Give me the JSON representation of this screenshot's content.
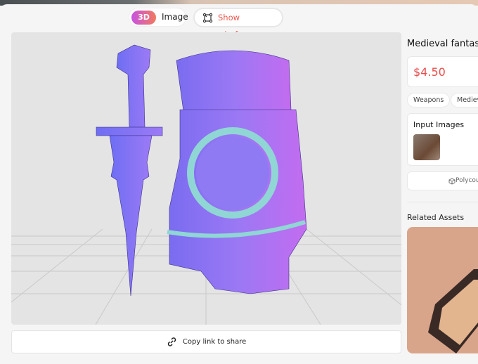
{
  "viewer_toggle": {
    "mode_3d": "3D",
    "mode_image": "Image",
    "wireframe": "Show wireframe"
  },
  "share": {
    "label": "Copy link to share"
  },
  "asset": {
    "title": "Medieval fantas",
    "price": "$4.50",
    "tags": [
      "Weapons",
      "Mediev"
    ],
    "input_images_label": "Input Images",
    "polycount_label": "Polycou"
  },
  "related": {
    "label": "Related Assets"
  },
  "colors": {
    "accent": "#e85a4f",
    "gradient_start": "#c653e4",
    "gradient_end": "#f27a5e"
  }
}
